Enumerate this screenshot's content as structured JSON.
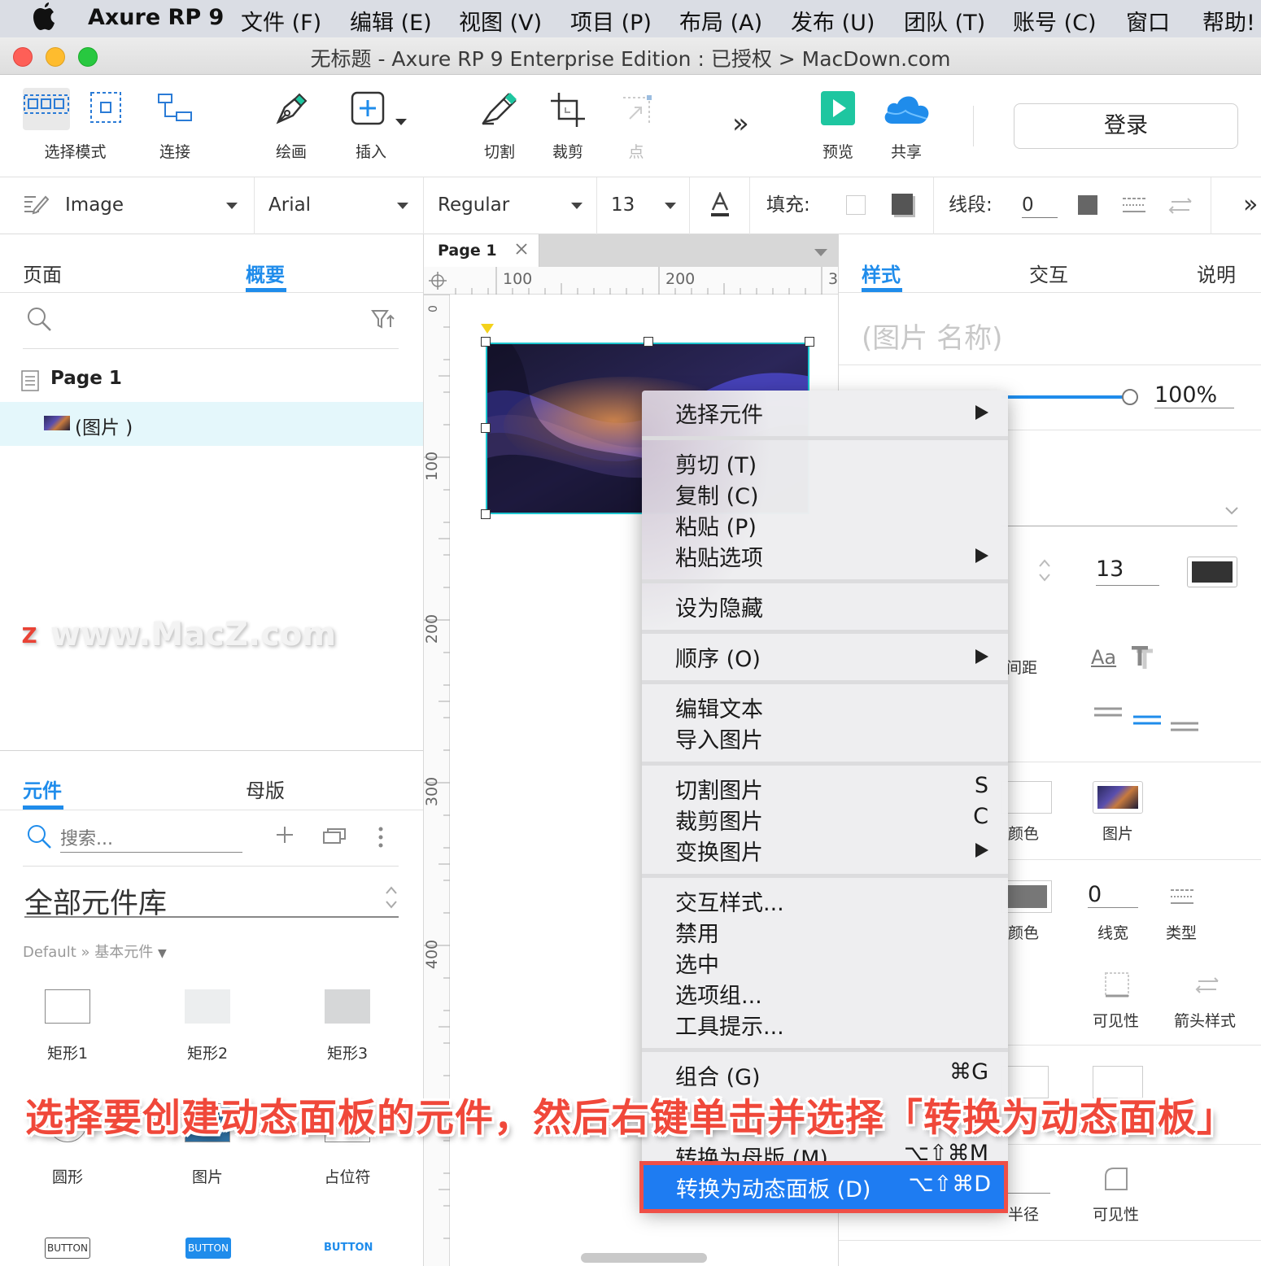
{
  "menubar": {
    "app_name": "Axure RP 9",
    "items": [
      "文件 (F)",
      "编辑 (E)",
      "视图 (V)",
      "项目 (P)",
      "布局 (A)",
      "发布 (U)",
      "团队 (T)",
      "账号 (C)",
      "窗口",
      "帮助!"
    ]
  },
  "window": {
    "title": "无标题 - Axure RP 9 Enterprise Edition : 已授权 > MacDown.com"
  },
  "toolbar": {
    "select_mode": "选择模式",
    "connect": "连接",
    "draw": "绘画",
    "insert": "插入",
    "slice": "切割",
    "crop": "裁剪",
    "point": "点",
    "more": "»",
    "preview": "预览",
    "share": "共享",
    "login": "登录"
  },
  "formatbar": {
    "style": "Image",
    "font": "Arial",
    "weight": "Regular",
    "size": "13",
    "fill_label": "填充:",
    "stroke_label": "线段:",
    "stroke_value": "0",
    "more": "»"
  },
  "left_panel": {
    "tabs": [
      "页面",
      "概要"
    ],
    "active_tab": "概要",
    "outline": {
      "page": "Page 1",
      "item": "(图片 )"
    },
    "library_tabs": [
      "元件",
      "母版"
    ],
    "active_library_tab": "元件",
    "search_placeholder": "搜索...",
    "library_name": "全部元件库",
    "library_path": "Default » 基本元件",
    "widgets": [
      {
        "label": "矩形1"
      },
      {
        "label": "矩形2"
      },
      {
        "label": "矩形3"
      },
      {
        "label": "圆形"
      },
      {
        "label": "图片"
      },
      {
        "label": "占位符"
      }
    ],
    "buttons": [
      "BUTTON",
      "BUTTON",
      "BUTTON"
    ]
  },
  "canvas": {
    "tab_label": "Page 1",
    "ruler_h": [
      "100",
      "200",
      "3"
    ],
    "ruler_v": [
      "0",
      "100",
      "200",
      "300",
      "400"
    ]
  },
  "right_panel": {
    "tabs": [
      "样式",
      "交互",
      "说明"
    ],
    "active_tab": "样式",
    "name_placeholder": "(图片 名称)",
    "opacity": "100%",
    "opacity_fraction": 1.0,
    "font_size": "13",
    "spacing_label": "间距",
    "fill_color_label": "颜色",
    "fill_image_label": "图片",
    "border_color_label": "颜色",
    "border_width_value": "0",
    "border_width_label": "线宽",
    "border_type_label": "类型",
    "visibility_label": "可见性",
    "arrow_style_label": "箭头样式",
    "radius_label": "半径",
    "visibility2_label": "可见性"
  },
  "context_menu": {
    "items": [
      {
        "label": "选择元件",
        "submenu": true
      },
      {
        "label": "剪切 (T)"
      },
      {
        "label": "复制 (C)"
      },
      {
        "label": "粘贴 (P)"
      },
      {
        "label": "粘贴选项",
        "submenu": true
      },
      {
        "label": "设为隐藏"
      },
      {
        "label": "顺序 (O)",
        "submenu": true
      },
      {
        "label": "编辑文本"
      },
      {
        "label": "导入图片"
      },
      {
        "label": "切割图片",
        "shortcut": "S"
      },
      {
        "label": "裁剪图片",
        "shortcut": "C"
      },
      {
        "label": "变换图片",
        "submenu": true
      },
      {
        "label": "交互样式..."
      },
      {
        "label": "禁用"
      },
      {
        "label": "选中"
      },
      {
        "label": "选项组..."
      },
      {
        "label": "工具提示..."
      },
      {
        "label": "组合 (G)",
        "shortcut": "⌘G"
      },
      {
        "label": "转换为母版 (M)",
        "shortcut": "⌥⇧⌘M"
      },
      {
        "label": "转换为动态面板 (D)",
        "shortcut": "⌥⇧⌘D",
        "highlighted": true
      }
    ]
  },
  "overlay": {
    "caption": "选择要创建动态面板的元件，然后右键单击并选择「转换为动态面板」",
    "watermark": "www.MacZ.com"
  },
  "colors": {
    "accent": "#1f8ceb",
    "highlight": "#1e7cf2",
    "caption_red": "#f0483a",
    "preview_green": "#1ec6a0"
  }
}
